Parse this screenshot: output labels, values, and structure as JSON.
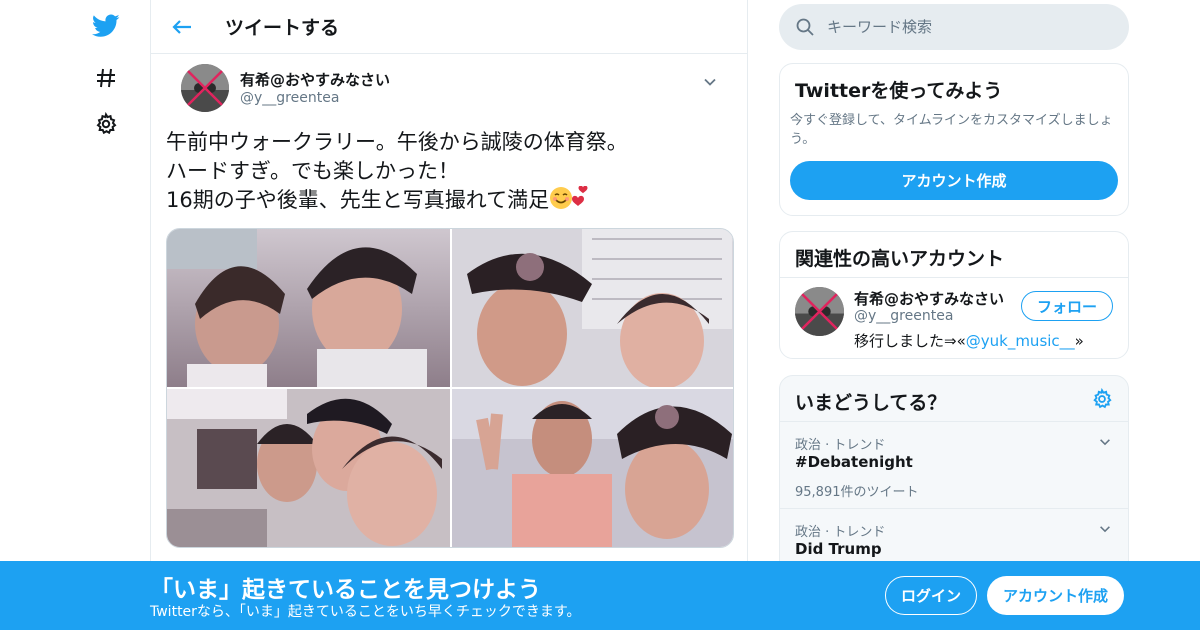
{
  "colors": {
    "accent": "#1da1f2",
    "border": "#e6ecf0",
    "muted": "#657786",
    "text": "#14171a"
  },
  "nav": {
    "icons": [
      "twitter-logo-icon",
      "hashtag-icon",
      "gear-icon"
    ]
  },
  "header": {
    "title": "ツイートする"
  },
  "tweet": {
    "name": "有希@おやすみなさい",
    "handle": "@y__greentea",
    "lines": [
      "午前中ウォークラリー。午後から誠陵の体育祭。",
      "ハードすぎ。でも楽しかった！",
      "16期の子や後輩、先生と写真撮れて満足"
    ],
    "emojis": [
      "smiling-face-icon",
      "two-hearts-icon"
    ],
    "photos": 4
  },
  "search": {
    "placeholder": "キーワード検索"
  },
  "signup_card": {
    "title": "Twitterを使ってみよう",
    "subtitle_line1": "今すぐ登録して、タイムラインをカスタマイズしましょ",
    "subtitle_line2": "う。",
    "button": "アカウント作成"
  },
  "related": {
    "title": "関連性の高いアカウント",
    "name": "有希@おやすみなさい",
    "handle": "@y__greentea",
    "bio_prefix": "移行しました⇒«",
    "bio_link": "@yuk_music__",
    "bio_suffix": "»",
    "follow": "フォロー"
  },
  "trends": {
    "title": "いまどうしてる？",
    "items": [
      {
        "meta": "政治 · トレンド",
        "name": "#Debatenight",
        "count": "95,891件のツイート"
      },
      {
        "meta": "政治 · トレンド",
        "name": "Did Trump",
        "count": ""
      }
    ]
  },
  "banner": {
    "title": "「いま」起きていることを見つけよう",
    "subtitle": "Twitterなら、「いま」起きていることをいち早くチェックできます。",
    "login": "ログイン",
    "signup": "アカウント作成"
  }
}
